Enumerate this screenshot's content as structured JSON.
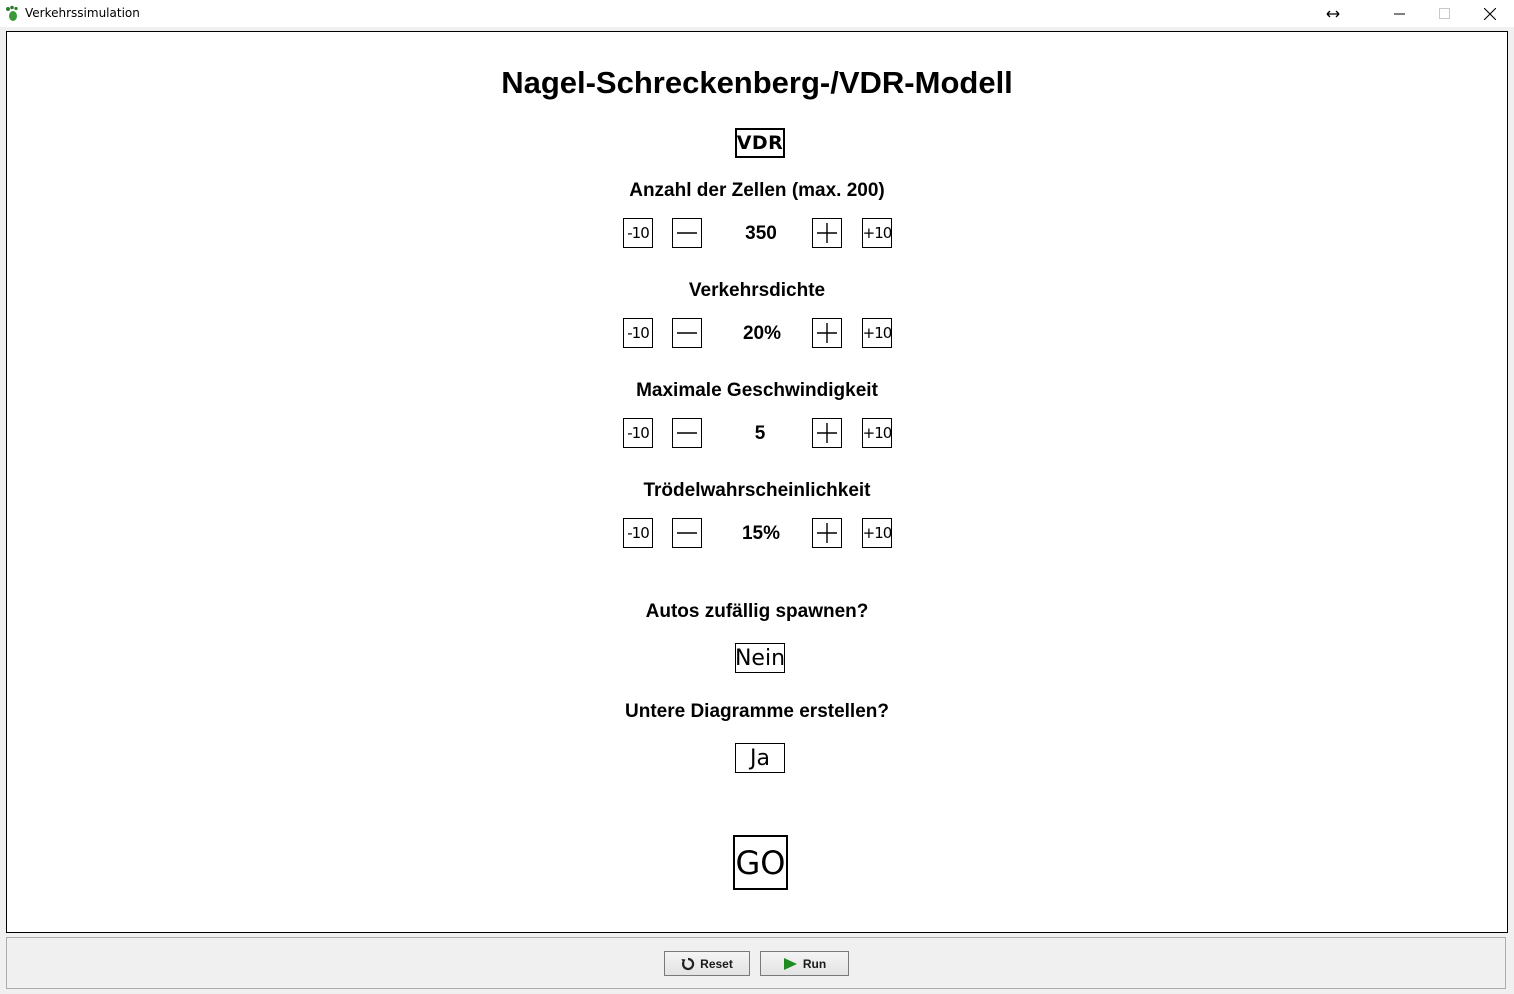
{
  "window": {
    "title": "Verkehrssimulation",
    "icon": "footprint-icon"
  },
  "page": {
    "title": "Nagel-Schreckenberg-/VDR-Modell",
    "model_toggle": "VDR"
  },
  "params": [
    {
      "label": "Anzahl der Zellen (max. 200)",
      "value": "350",
      "minus10": "-10",
      "plus10": "+10"
    },
    {
      "label": "Verkehrsdichte",
      "value": "20%",
      "minus10": "-10",
      "plus10": "+10"
    },
    {
      "label": "Maximale Geschwindigkeit",
      "value": "5",
      "minus10": "-10",
      "plus10": "+10"
    },
    {
      "label": "Trödelwahrscheinlichkeit",
      "value": "15%",
      "minus10": "-10",
      "plus10": "+10"
    }
  ],
  "options": {
    "spawn": {
      "label": "Autos zufällig spawnen?",
      "value": "Nein"
    },
    "diagrams": {
      "label": "Untere Diagramme erstellen?",
      "value": "Ja"
    }
  },
  "go_label": "GO",
  "controls": {
    "reset_label": "Reset",
    "run_label": "Run"
  },
  "colors": {
    "run_icon": "#1f8a1f",
    "app_icon": "#3a9a3a"
  }
}
